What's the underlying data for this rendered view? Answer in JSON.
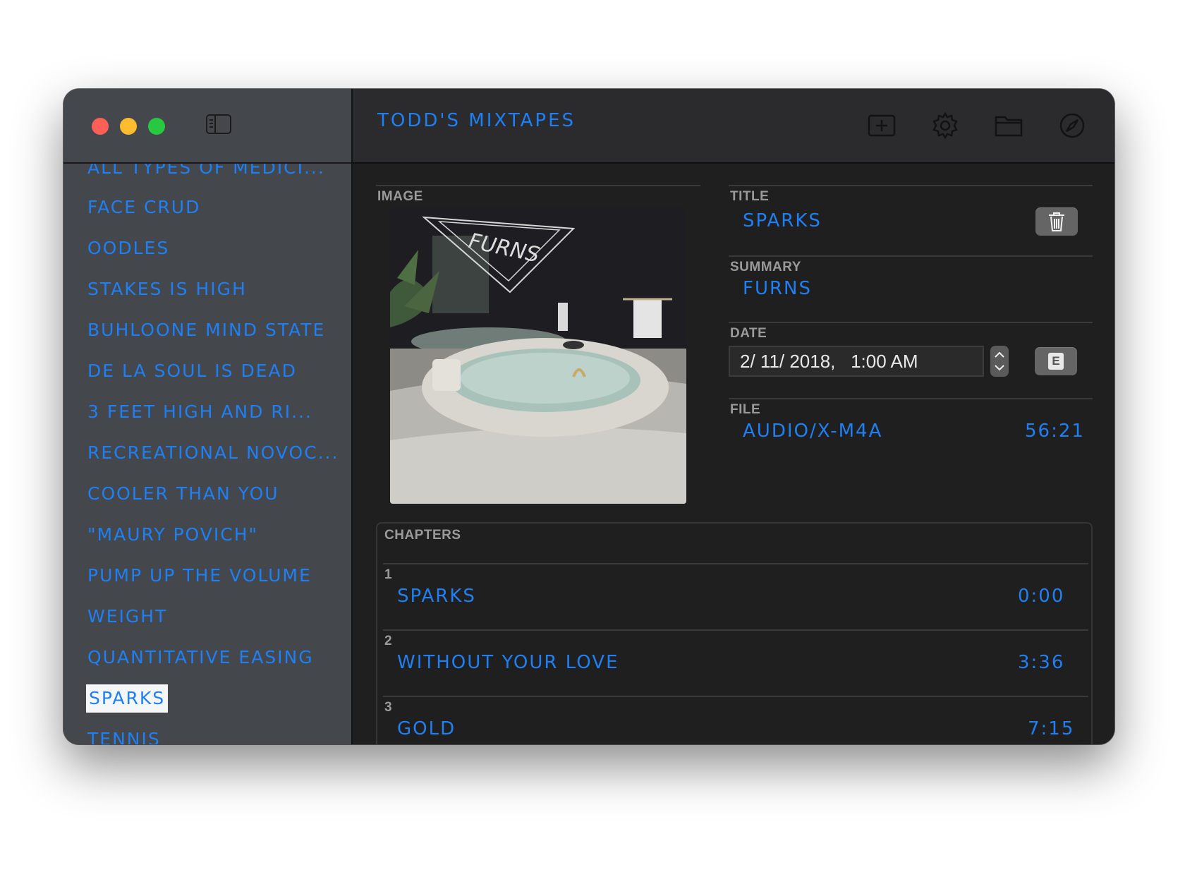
{
  "app": {
    "title": "TODD'S MIXTAPES"
  },
  "sidebar": {
    "items": [
      "ALL TYPES OF MEDICI...",
      "FACE CRUD",
      "OODLES",
      "STAKES IS HIGH",
      "BUHLOONE MIND STATE",
      "DE LA SOUL IS DEAD",
      "3 FEET HIGH AND RI...",
      "RECREATIONAL NOVOC...",
      "COOLER THAN YOU",
      "\"MAURY POVICH\"",
      "PUMP UP THE VOLUME",
      "WEIGHT",
      "QUANTITATIVE EASING",
      "SPARKS",
      "TENNIS"
    ],
    "selected_index": 13
  },
  "toolbar": {
    "icons": [
      "add-icon",
      "gear-icon",
      "folder-icon",
      "compass-icon"
    ]
  },
  "detail": {
    "image_label": "IMAGE",
    "album_art_text": "FURNS",
    "title_label": "TITLE",
    "title_value": "SPARKS",
    "summary_label": "SUMMARY",
    "summary_value": "FURNS",
    "date_label": "DATE",
    "date_value": "2/ 11/ 2018,   1:00 AM",
    "date_button_label": "E",
    "file_label": "FILE",
    "file_value": "AUDIO/X-M4A",
    "file_duration": "56:21"
  },
  "chapters": {
    "label": "CHAPTERS",
    "items": [
      {
        "number": "1",
        "title": "SPARKS",
        "time": "0:00"
      },
      {
        "number": "2",
        "title": "WITHOUT YOUR LOVE",
        "time": "3:36"
      },
      {
        "number": "3",
        "title": "GOLD",
        "time": "7:15"
      }
    ]
  },
  "colors": {
    "accent": "#1f7ff5",
    "sidebar_bg": "#44474b",
    "main_bg": "#1f1f1f",
    "toolbar_bg": "#2b2b2d"
  }
}
